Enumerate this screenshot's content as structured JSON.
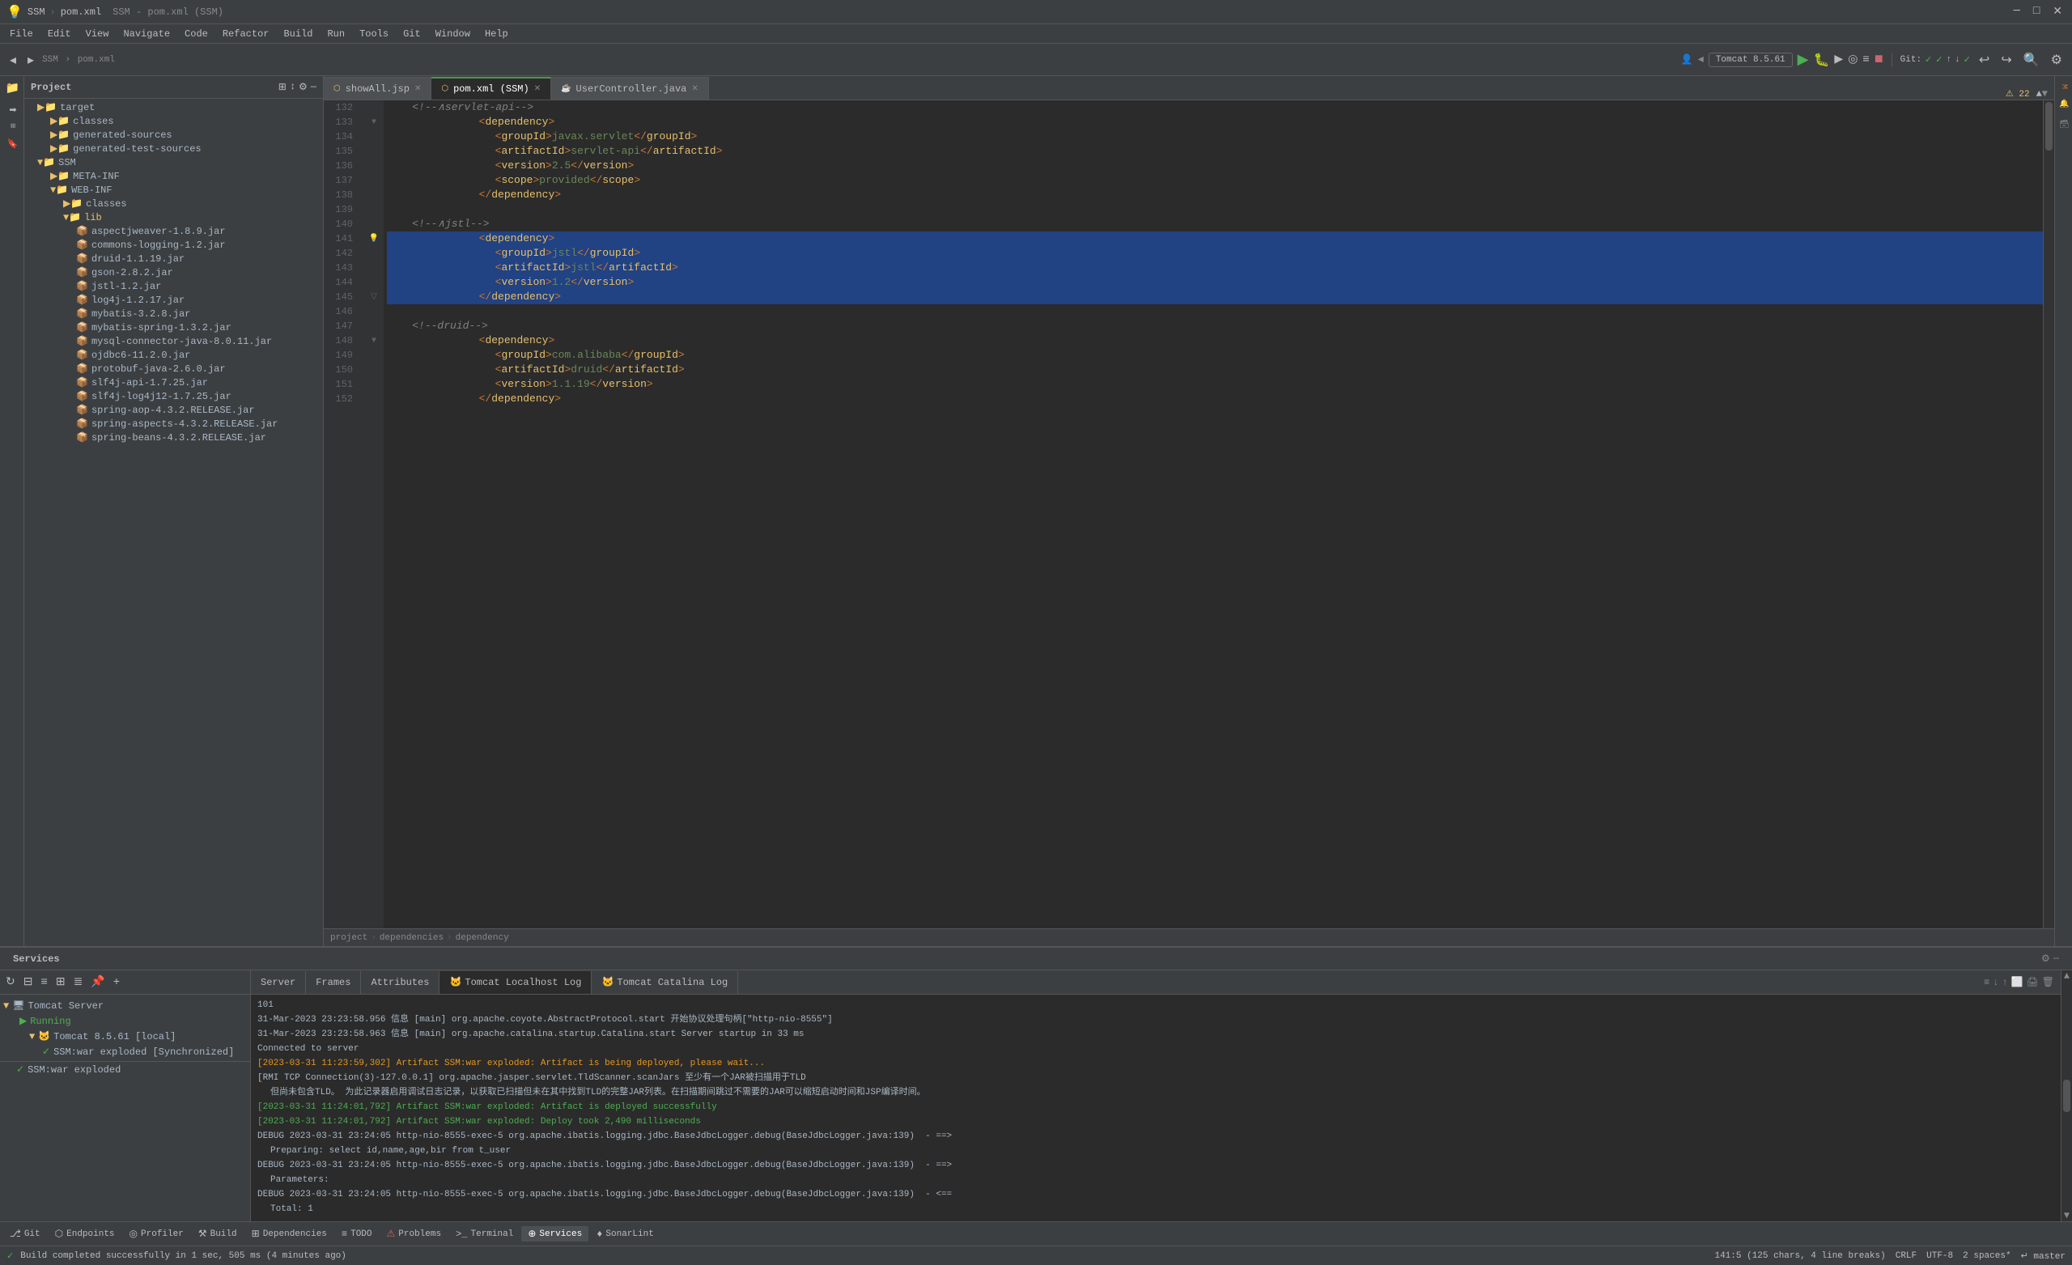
{
  "window": {
    "title": "SSM - pom.xml (SSM)",
    "minimize": "─",
    "maximize": "□",
    "close": "✕"
  },
  "menubar": {
    "items": [
      "File",
      "Edit",
      "View",
      "Navigate",
      "Code",
      "Refactor",
      "Build",
      "Run",
      "Tools",
      "Git",
      "Window",
      "Help"
    ]
  },
  "toolbar": {
    "project_label": "SSM",
    "file_label": "pom.xml",
    "run_config": "Tomcat 8.5.61",
    "git_label": "Git:",
    "git_checkmark1": "✓",
    "git_checkmark2": "✓",
    "git_checkmark3": "✓"
  },
  "file_tree": {
    "title": "Project",
    "items": [
      {
        "label": "target",
        "indent": 1,
        "type": "folder"
      },
      {
        "label": "classes",
        "indent": 2,
        "type": "folder"
      },
      {
        "label": "generated-sources",
        "indent": 2,
        "type": "folder"
      },
      {
        "label": "generated-test-sources",
        "indent": 2,
        "type": "folder"
      },
      {
        "label": "SSM",
        "indent": 1,
        "type": "folder"
      },
      {
        "label": "META-INF",
        "indent": 2,
        "type": "folder"
      },
      {
        "label": "WEB-INF",
        "indent": 2,
        "type": "folder"
      },
      {
        "label": "classes",
        "indent": 3,
        "type": "folder"
      },
      {
        "label": "lib",
        "indent": 3,
        "type": "folder",
        "open": true
      },
      {
        "label": "aspectjweaver-1.8.9.jar",
        "indent": 4,
        "type": "jar"
      },
      {
        "label": "commons-logging-1.2.jar",
        "indent": 4,
        "type": "jar"
      },
      {
        "label": "druid-1.1.19.jar",
        "indent": 4,
        "type": "jar"
      },
      {
        "label": "gson-2.8.2.jar",
        "indent": 4,
        "type": "jar"
      },
      {
        "label": "jstl-1.2.jar",
        "indent": 4,
        "type": "jar"
      },
      {
        "label": "log4j-1.2.17.jar",
        "indent": 4,
        "type": "jar"
      },
      {
        "label": "mybatis-3.2.8.jar",
        "indent": 4,
        "type": "jar"
      },
      {
        "label": "mybatis-spring-1.3.2.jar",
        "indent": 4,
        "type": "jar"
      },
      {
        "label": "mysql-connector-java-8.0.11.jar",
        "indent": 4,
        "type": "jar"
      },
      {
        "label": "ojdbc6-11.2.0.jar",
        "indent": 4,
        "type": "jar"
      },
      {
        "label": "protobuf-java-2.6.0.jar",
        "indent": 4,
        "type": "jar"
      },
      {
        "label": "slf4j-api-1.7.25.jar",
        "indent": 4,
        "type": "jar"
      },
      {
        "label": "slf4j-log4j12-1.7.25.jar",
        "indent": 4,
        "type": "jar"
      },
      {
        "label": "spring-aop-4.3.2.RELEASE.jar",
        "indent": 4,
        "type": "jar"
      },
      {
        "label": "spring-aspects-4.3.2.RELEASE.jar",
        "indent": 4,
        "type": "jar"
      },
      {
        "label": "spring-beans-4.3.2.RELEASE.jar",
        "indent": 4,
        "type": "jar"
      }
    ]
  },
  "editor": {
    "tabs": [
      {
        "label": "showAll.jsp",
        "active": false,
        "closeable": true
      },
      {
        "label": "pom.xml (SSM)",
        "active": true,
        "closeable": true,
        "modified": false
      },
      {
        "label": "UserController.java",
        "active": false,
        "closeable": true
      }
    ],
    "breadcrumb": [
      "project",
      "dependencies",
      "dependency"
    ],
    "line_count_warning": "22",
    "lines": [
      {
        "num": 132,
        "content": "    <!--∧servlet-api-->",
        "type": "comment"
      },
      {
        "num": 133,
        "content": "    <dependency>",
        "type": "tag"
      },
      {
        "num": 134,
        "content": "        <groupId>javax.servlet</groupId>",
        "type": "tag"
      },
      {
        "num": 135,
        "content": "        <artifactId>servlet-api</artifactId>",
        "type": "tag"
      },
      {
        "num": 136,
        "content": "        <version>2.5</version>",
        "type": "tag"
      },
      {
        "num": 137,
        "content": "        <scope>provided</scope>",
        "type": "tag"
      },
      {
        "num": 138,
        "content": "    </dependency>",
        "type": "tag"
      },
      {
        "num": 139,
        "content": "",
        "type": "empty"
      },
      {
        "num": 140,
        "content": "",
        "type": "empty"
      },
      {
        "num": 141,
        "content": "    <dependency>",
        "type": "tag",
        "selected": true,
        "warning": true
      },
      {
        "num": 142,
        "content": "        <groupId>jstl</groupId>",
        "type": "tag",
        "selected": true
      },
      {
        "num": 143,
        "content": "        <artifactId>jstl</artifactId>",
        "type": "tag",
        "selected": true
      },
      {
        "num": 144,
        "content": "        <version>1.2</version>",
        "type": "tag",
        "selected": true
      },
      {
        "num": 145,
        "content": "    </dependency>",
        "type": "tag",
        "selected": true
      },
      {
        "num": 146,
        "content": "",
        "type": "empty"
      },
      {
        "num": 147,
        "content": "    <!--druid-->",
        "type": "comment"
      },
      {
        "num": 148,
        "content": "    <dependency>",
        "type": "tag"
      },
      {
        "num": 149,
        "content": "        <groupId>com.alibaba</groupId>",
        "type": "tag"
      },
      {
        "num": 150,
        "content": "        <artifactId>druid</artifactId>",
        "type": "tag"
      },
      {
        "num": 151,
        "content": "        <version>1.1.19</version>",
        "type": "tag"
      },
      {
        "num": 152,
        "content": "    </dependency>",
        "type": "tag"
      }
    ]
  },
  "services": {
    "panel_title": "Services",
    "tree": {
      "tomcat_server": "Tomcat Server",
      "running": "Running",
      "tomcat_instance": "Tomcat 8.5.61 [local]",
      "deployment": "SSM:war exploded [Synchronized]",
      "deployment_check": "SSM:war exploded"
    },
    "server_tabs": [
      "Server",
      "Frames",
      "Attributes",
      "Tomcat Localhost Log",
      "Tomcat Catalina Log"
    ],
    "log_lines": [
      {
        "text": "101",
        "class": "log-info"
      },
      {
        "text": "31-Mar-2023 23:23:58.956 信息 [main] org.apache.coyote.AbstractProtocol.start 开始协议处理句柄[\"http-nio-8555\"]",
        "class": "log-info"
      },
      {
        "text": "31-Mar-2023 23:23:58.963 信息 [main] org.apache.catalina.startup.Catalina.start Server startup in 33 ms",
        "class": "log-info"
      },
      {
        "text": "Connected to server",
        "class": "log-info"
      },
      {
        "text": "[2023-03-31 11:23:59,302] Artifact SSM:war exploded: Artifact is being deployed, please wait...",
        "class": "log-orange"
      },
      {
        "text": "[RMI TCP Connection(3)-127.0.0.1] org.apache.jasper.servlet.TldScanner.scanJars 至少有一个JAR被扫描用于TLD",
        "class": "log-info"
      },
      {
        "text": "  但尚未包含TLD。为此记录器启用调试日志记录，以获取已扫描但未在其中找到TLD的完整JAR列表。在扫描期间跳过不需要的JAR可以缩短启动时间和JSP编译时间。",
        "class": "log-info"
      },
      {
        "text": "[2023-03-31 11:24:01,792] Artifact SSM:war exploded: Artifact is deployed successfully",
        "class": "log-green"
      },
      {
        "text": "[2023-03-31 11:24:01,792] Artifact SSM:war exploded: Deploy took 2,490 milliseconds",
        "class": "log-green"
      },
      {
        "text": "DEBUG 2023-03-31 23:24:05 http-nio-8555-exec-5 org.apache.ibatis.logging.jdbc.BaseJdbcLogger.debug(BaseJdbcLogger.java:139)  - ==>",
        "class": "log-debug"
      },
      {
        "text": "  Preparing: select id,name,age,bir from t_user",
        "class": "log-debug"
      },
      {
        "text": "DEBUG 2023-03-31 23:24:05 http-nio-8555-exec-5 org.apache.ibatis.logging.jdbc.BaseJdbcLogger.debug(BaseJdbcLogger.java:139)  - ==>",
        "class": "log-debug"
      },
      {
        "text": "  Parameters:",
        "class": "log-debug"
      },
      {
        "text": "DEBUG 2023-03-31 23:24:05 http-nio-8555-exec-5 org.apache.ibatis.logging.jdbc.BaseJdbcLogger.debug(BaseJdbcLogger.java:139)  - <==",
        "class": "log-debug"
      },
      {
        "text": "  Total: 1",
        "class": "log-debug"
      }
    ]
  },
  "bottom_toolbar": {
    "items": [
      {
        "label": "Git",
        "icon": "⎇",
        "active": false
      },
      {
        "label": "Endpoints",
        "icon": "⬡",
        "active": false
      },
      {
        "label": "Profiler",
        "icon": "◎",
        "active": false
      },
      {
        "label": "Build",
        "icon": "⚒",
        "active": false
      },
      {
        "label": "Dependencies",
        "icon": "⊞",
        "active": false
      },
      {
        "label": "TODO",
        "icon": "≡",
        "active": false
      },
      {
        "label": "Problems",
        "icon": "⚠",
        "active": false
      },
      {
        "label": "Terminal",
        "icon": ">_",
        "active": false
      },
      {
        "label": "Services",
        "icon": "⊕",
        "active": true
      },
      {
        "label": "SonarLint",
        "icon": "♦",
        "active": false
      }
    ]
  },
  "statusbar": {
    "build_message": "Build completed successfully in 1 sec, 505 ms (4 minutes ago)",
    "position": "141:5 (125 chars, 4 line breaks)",
    "line_ending": "CRLF",
    "encoding": "UTF-8",
    "indent": "2 spaces*",
    "branch": "↵ master"
  },
  "right_sidebar": {
    "items": [
      "Maven",
      "Build",
      "Notifications",
      "Database"
    ]
  }
}
